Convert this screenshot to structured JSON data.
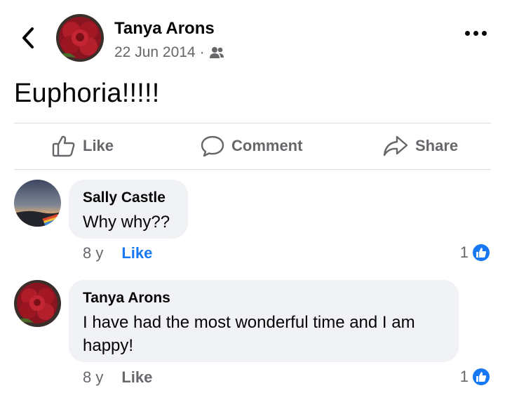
{
  "post": {
    "author": "Tanya Arons",
    "date": "22 Jun 2014",
    "separator": "·",
    "audience_icon": "friends-icon",
    "text": "Euphoria!!!!!"
  },
  "actions": {
    "like": "Like",
    "comment": "Comment",
    "share": "Share"
  },
  "comments": [
    {
      "author": "Sally Castle",
      "text": "Why why??",
      "age": "8 y",
      "like_label": "Like",
      "like_count": "1",
      "like_active": true
    },
    {
      "author": "Tanya Arons",
      "text": "I have had the most  wonderful time and I am happy!",
      "age": "8 y",
      "like_label": "Like",
      "like_count": "1",
      "like_active": false
    }
  ],
  "colors": {
    "accent": "#1877f2",
    "muted": "#65676b",
    "bubble": "#f0f2f5"
  }
}
